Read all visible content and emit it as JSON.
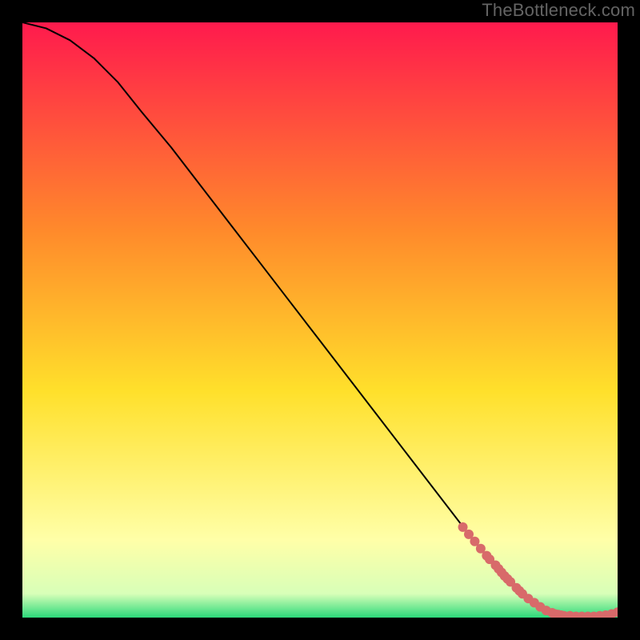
{
  "attribution": "TheBottleneck.com",
  "colors": {
    "gradient_top": "#ff1a4d",
    "gradient_upper": "#ff8a2b",
    "gradient_mid": "#ffe02b",
    "gradient_lower": "#ffffa8",
    "gradient_bottom": "#2bd97a",
    "curve": "#000000",
    "dots": "#d86a6a"
  },
  "chart_data": {
    "type": "line",
    "title": "",
    "xlabel": "",
    "ylabel": "",
    "xlim": [
      0,
      100
    ],
    "ylim": [
      0,
      100
    ],
    "curve": {
      "x": [
        0,
        4,
        8,
        12,
        16,
        20,
        25,
        30,
        35,
        40,
        45,
        50,
        55,
        60,
        65,
        70,
        75,
        80,
        85,
        88,
        90,
        92,
        94,
        96,
        98,
        100
      ],
      "y": [
        100,
        99,
        97,
        94,
        90,
        85,
        79,
        72.5,
        66,
        59.5,
        53,
        46.5,
        40,
        33.5,
        27,
        20.5,
        14,
        8,
        3,
        1.2,
        0.6,
        0.3,
        0.2,
        0.2,
        0.3,
        0.8
      ]
    },
    "scatter": {
      "x": [
        74,
        75,
        76,
        77,
        78,
        78.5,
        79.5,
        80,
        80.5,
        81,
        81.5,
        82,
        83,
        83.5,
        84,
        85,
        86,
        87,
        88,
        89,
        89.5,
        90,
        90.5,
        91,
        92,
        93,
        94,
        95,
        96,
        97,
        98,
        99,
        100
      ],
      "y": [
        15.2,
        14.0,
        12.8,
        11.6,
        10.4,
        9.8,
        8.8,
        8.2,
        7.6,
        7.0,
        6.5,
        6.0,
        5.0,
        4.5,
        4.0,
        3.2,
        2.5,
        1.8,
        1.2,
        0.8,
        0.6,
        0.5,
        0.4,
        0.3,
        0.3,
        0.2,
        0.2,
        0.2,
        0.2,
        0.3,
        0.4,
        0.6,
        0.9
      ]
    }
  }
}
